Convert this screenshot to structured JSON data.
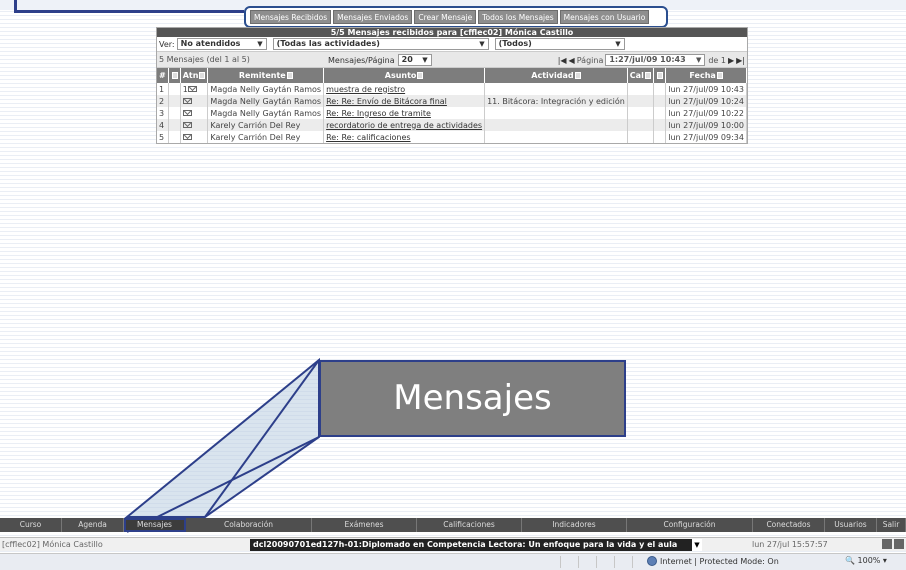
{
  "tabs": [
    "Mensajes Recibidos",
    "Mensajes Enviados",
    "Crear Mensaje",
    "Todos los Mensajes",
    "Mensajes con Usuario"
  ],
  "panel": {
    "title": "5/5  Mensajes recibidos para [cfflec02] Mónica Castillo",
    "filter_label": "Ver:",
    "filter_status": "No atendidos",
    "filter_activity": "(Todas las actividades)",
    "filter_all": "(Todos)",
    "count_text": "5 Mensajes (del 1 al 5)",
    "per_page_label": "Mensajes/Página",
    "per_page_value": "20",
    "page_label": "Página",
    "page_value": "1:27/jul/09 10:43",
    "page_of": "de 1",
    "columns": [
      "#",
      "",
      "Atn",
      "Remitente",
      "Asunto",
      "Actividad",
      "Cal",
      "",
      "Fecha"
    ],
    "rows": [
      {
        "n": "1",
        "atn": "1",
        "from": "Magda Nelly Gaytán Ramos",
        "subject": "muestra de registro",
        "activity": "",
        "date": "lun 27/jul/09 10:43"
      },
      {
        "n": "2",
        "atn": "",
        "from": "Magda Nelly Gaytán Ramos",
        "subject": "Re: Re: Envío de Bitácora final",
        "activity": "11. Bitácora: Integración y edición",
        "date": "lun 27/jul/09 10:24"
      },
      {
        "n": "3",
        "atn": "",
        "from": "Magda Nelly Gaytán Ramos",
        "subject": "Re: Re: Ingreso de tramite",
        "activity": "",
        "date": "lun 27/jul/09 10:22"
      },
      {
        "n": "4",
        "atn": "",
        "from": "Karely Carrión Del Rey",
        "subject": "recordatorio de entrega de actividades",
        "activity": "",
        "date": "lun 27/jul/09 10:00"
      },
      {
        "n": "5",
        "atn": "",
        "from": "Karely Carrión Del Rey",
        "subject": "Re: Re: calificaciones",
        "activity": "",
        "date": "lun 27/jul/09 09:34"
      }
    ]
  },
  "callout": {
    "label": "Mensajes"
  },
  "bottom_nav": [
    "Curso",
    "Agenda",
    "Mensajes",
    "Colaboración",
    "Exámenes",
    "Calificaciones",
    "Indicadores",
    "Configuración",
    "Conectados",
    "Usuarios",
    "Salir"
  ],
  "bottom_nav_active": "Mensajes",
  "status": {
    "user": "[cfflec02] Mónica Castillo",
    "course": "dcl20090701ed127h-01:Diplomado en Competencia Lectora: Un enfoque para la vida y el aula",
    "datetime": "lun 27/jul 15:57:57"
  },
  "browser": {
    "zone": "Internet | Protected Mode: On",
    "zoom": "100%"
  },
  "colors": {
    "accent": "#2d3f8a",
    "header": "#7d7d7d",
    "nav": "#4f4f4f"
  }
}
